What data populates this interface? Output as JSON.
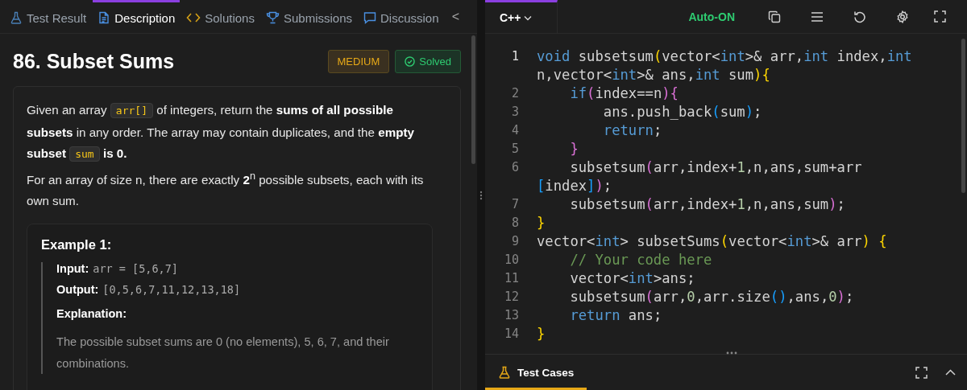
{
  "tabs": [
    {
      "label": "Test Result",
      "selected": false
    },
    {
      "label": "Description",
      "selected": true
    },
    {
      "label": "Solutions",
      "selected": false
    },
    {
      "label": "Submissions",
      "selected": false
    },
    {
      "label": "Discussion",
      "selected": false
    }
  ],
  "tabs_collapse": "<",
  "problem": {
    "title": "86. Subset Sums",
    "difficulty": "MEDIUM",
    "status": "Solved",
    "paragraphs": [
      [
        {
          "kind": "text",
          "text": "Given an array "
        },
        {
          "kind": "code",
          "text": "arr[]"
        },
        {
          "kind": "text",
          "text": " of integers, return the **sums of all possible subsets** in any order. The array may contain duplicates, and the **empty subset** "
        },
        {
          "kind": "code",
          "text": "sum"
        },
        {
          "kind": "text",
          "text": " **is 0.**"
        }
      ],
      [
        {
          "kind": "text",
          "text": "For an array of size n, there are exactly **2**$^{n}$ possible subsets, each with its own sum."
        }
      ]
    ],
    "example": {
      "title": "Example 1:",
      "input_label": "Input:",
      "input": "arr = [5,6,7]",
      "output_label": "Output:",
      "output": "[0,5,6,7,11,12,13,18]",
      "explanation_label": "Explanation:",
      "explanation": "The possible subset sums are 0 (no elements), 5, 6, 7, and their combinations."
    }
  },
  "editor": {
    "language": "C++",
    "autosave": "Auto-ON",
    "lines": [
      {
        "number": "1",
        "active": true,
        "tokens": [
          {
            "text": "void",
            "kind": "keyword"
          },
          {
            "text": " subsetsum",
            "kind": "plain"
          },
          {
            "text": "(",
            "kind": "bracket1"
          },
          {
            "text": "vector<",
            "kind": "plain"
          },
          {
            "text": "int",
            "kind": "keyword"
          },
          {
            "text": ">& arr,",
            "kind": "plain"
          },
          {
            "text": "int",
            "kind": "keyword"
          },
          {
            "text": " index,",
            "kind": "plain"
          },
          {
            "text": "int",
            "kind": "keyword"
          },
          {
            "kind": "wrap"
          },
          {
            "text": "n,vector<",
            "kind": "plain"
          },
          {
            "text": "int",
            "kind": "keyword"
          },
          {
            "text": ">& ans,",
            "kind": "plain"
          },
          {
            "text": "int",
            "kind": "keyword"
          },
          {
            "text": " sum",
            "kind": "plain"
          },
          {
            "text": "){",
            "kind": "bracket1"
          }
        ]
      },
      {
        "number": "2",
        "active": false,
        "tokens": [
          {
            "text": "    if",
            "kind": "keyword"
          },
          {
            "text": "(",
            "kind": "bracket2"
          },
          {
            "text": "index==n",
            "kind": "plain"
          },
          {
            "text": "){",
            "kind": "bracket2"
          }
        ]
      },
      {
        "number": "3",
        "active": false,
        "tokens": [
          {
            "text": "        ans.push_back",
            "kind": "plain"
          },
          {
            "text": "(",
            "kind": "bracket3"
          },
          {
            "text": "sum",
            "kind": "plain"
          },
          {
            "text": ")",
            "kind": "bracket3"
          },
          {
            "text": ";",
            "kind": "plain"
          }
        ]
      },
      {
        "number": "4",
        "active": false,
        "tokens": [
          {
            "text": "        return",
            "kind": "keyword"
          },
          {
            "text": ";",
            "kind": "plain"
          }
        ]
      },
      {
        "number": "5",
        "active": false,
        "tokens": [
          {
            "text": "    }",
            "kind": "bracket2"
          }
        ]
      },
      {
        "number": "6",
        "active": false,
        "tokens": [
          {
            "text": "    subsetsum",
            "kind": "plain"
          },
          {
            "text": "(",
            "kind": "bracket2"
          },
          {
            "text": "arr,index+",
            "kind": "plain"
          },
          {
            "text": "1",
            "kind": "number"
          },
          {
            "text": ",n,ans,sum+arr",
            "kind": "plain"
          },
          {
            "kind": "wrap"
          },
          {
            "text": "[",
            "kind": "bracket3"
          },
          {
            "text": "index",
            "kind": "plain"
          },
          {
            "text": "]",
            "kind": "bracket3"
          },
          {
            "text": ")",
            "kind": "bracket2"
          },
          {
            "text": ";",
            "kind": "plain"
          }
        ]
      },
      {
        "number": "7",
        "active": false,
        "tokens": [
          {
            "text": "    subsetsum",
            "kind": "plain"
          },
          {
            "text": "(",
            "kind": "bracket2"
          },
          {
            "text": "arr,index+",
            "kind": "plain"
          },
          {
            "text": "1",
            "kind": "number"
          },
          {
            "text": ",n,ans,sum",
            "kind": "plain"
          },
          {
            "text": ")",
            "kind": "bracket2"
          },
          {
            "text": ";",
            "kind": "plain"
          }
        ]
      },
      {
        "number": "8",
        "active": false,
        "tokens": [
          {
            "text": "}",
            "kind": "bracket1"
          }
        ]
      },
      {
        "number": "9",
        "active": false,
        "tokens": [
          {
            "text": "vector<",
            "kind": "plain"
          },
          {
            "text": "int",
            "kind": "keyword"
          },
          {
            "text": "> subsetSums",
            "kind": "plain"
          },
          {
            "text": "(",
            "kind": "bracket1"
          },
          {
            "text": "vector<",
            "kind": "plain"
          },
          {
            "text": "int",
            "kind": "keyword"
          },
          {
            "text": ">& arr",
            "kind": "plain"
          },
          {
            "text": ")",
            "kind": "bracket1"
          },
          {
            "text": " {",
            "kind": "bracket1"
          }
        ]
      },
      {
        "number": "10",
        "active": false,
        "tokens": [
          {
            "text": "    // Your code here",
            "kind": "comment"
          }
        ]
      },
      {
        "number": "11",
        "active": false,
        "tokens": [
          {
            "text": "    vector<",
            "kind": "plain"
          },
          {
            "text": "int",
            "kind": "keyword"
          },
          {
            "text": ">ans;",
            "kind": "plain"
          }
        ]
      },
      {
        "number": "12",
        "active": false,
        "tokens": [
          {
            "text": "    subsetsum",
            "kind": "plain"
          },
          {
            "text": "(",
            "kind": "bracket2"
          },
          {
            "text": "arr,",
            "kind": "plain"
          },
          {
            "text": "0",
            "kind": "number"
          },
          {
            "text": ",arr.size",
            "kind": "plain"
          },
          {
            "text": "()",
            "kind": "bracket3"
          },
          {
            "text": ",ans,",
            "kind": "plain"
          },
          {
            "text": "0",
            "kind": "number"
          },
          {
            "text": ")",
            "kind": "bracket2"
          },
          {
            "text": ";",
            "kind": "plain"
          }
        ]
      },
      {
        "number": "13",
        "active": false,
        "tokens": [
          {
            "text": "    return",
            "kind": "keyword"
          },
          {
            "text": " ans;",
            "kind": "plain"
          }
        ]
      },
      {
        "number": "14",
        "active": false,
        "tokens": [
          {
            "text": "}",
            "kind": "bracket1"
          }
        ]
      }
    ]
  },
  "test_panel": {
    "title": "Test Cases"
  }
}
